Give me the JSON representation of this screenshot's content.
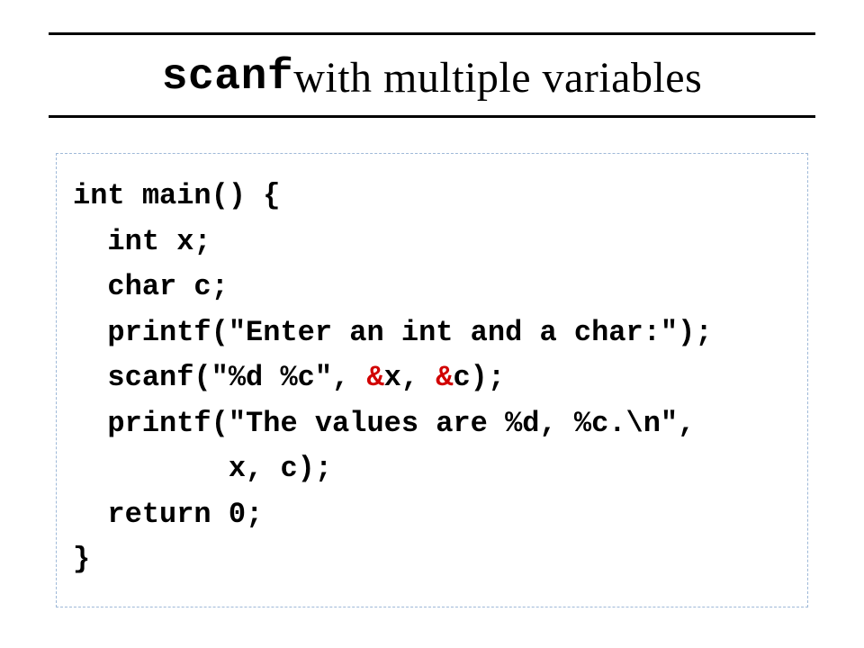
{
  "title": {
    "keyword": "scanf",
    "rest": " with multiple variables"
  },
  "code": {
    "l1": "int main() {",
    "l2": "  int x;",
    "l3": "  char c;",
    "l4": "  printf(\"Enter an int and a char:\");",
    "l5a": "  scanf(\"%d %c\", ",
    "amp1": "&",
    "l5b": "x, ",
    "amp2": "&",
    "l5c": "c);",
    "l6": "  printf(\"The values are %d, %c.\\n\",",
    "l7": "         x, c);",
    "l8": "  return 0;",
    "l9": "}"
  }
}
